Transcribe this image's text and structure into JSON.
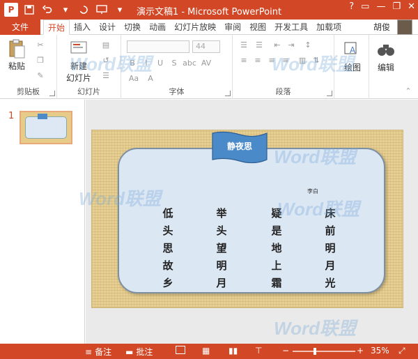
{
  "app": {
    "title": "演示文稿1 - Microsoft PowerPoint",
    "logo_letter": "P",
    "brand_color": "#d24726"
  },
  "window_controls": [
    "?",
    "▭",
    "—",
    "❐",
    "✕"
  ],
  "ribbon_tabs": {
    "file": "文件",
    "items": [
      "开始",
      "插入",
      "设计",
      "切换",
      "动画",
      "幻灯片放映",
      "审阅",
      "视图",
      "开发工具",
      "加载项"
    ],
    "active": "开始",
    "user": "胡俊"
  },
  "ribbon": {
    "clipboard": {
      "paste": "粘贴",
      "label": "剪贴板"
    },
    "slides": {
      "new_slide_line1": "新建",
      "new_slide_line2": "幻灯片",
      "label": "幻灯片"
    },
    "font": {
      "size": "44",
      "label": "字体",
      "buttons": [
        "B",
        "I",
        "U",
        "S",
        "abc",
        "AV",
        "Aa",
        "A"
      ]
    },
    "paragraph": {
      "label": "段落"
    },
    "drawing": {
      "label": "绘图"
    },
    "editing": {
      "label": "编辑"
    }
  },
  "thumbnails": [
    {
      "number": "1"
    }
  ],
  "slide": {
    "title": "静夜思",
    "author": "李白",
    "columns": [
      "床前明月光",
      "疑是地上霜",
      "举头望明月",
      "低头思故乡"
    ]
  },
  "watermark_text": "Word联盟",
  "statusbar": {
    "notes": "备注",
    "comments": "批注",
    "zoom": "35%",
    "zoom_level": 0.35
  }
}
